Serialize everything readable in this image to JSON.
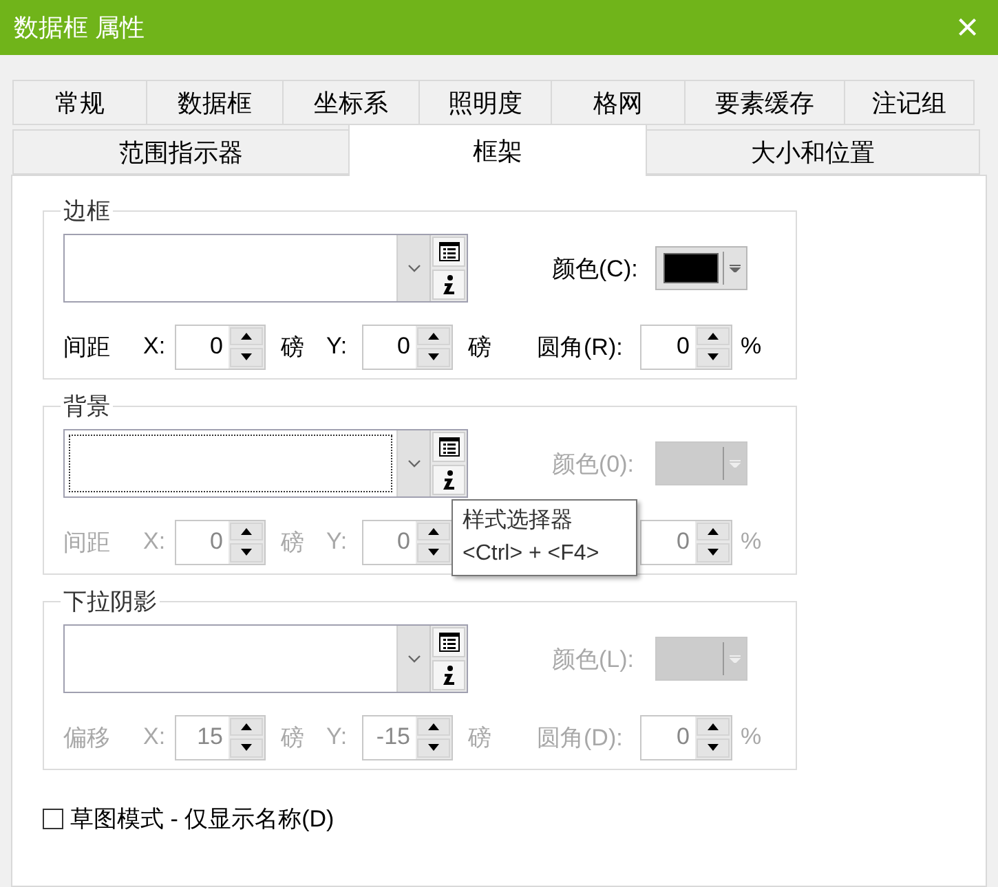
{
  "window": {
    "title": "数据框 属性",
    "close": "×"
  },
  "tab_rows": [
    [
      {
        "label": "常规",
        "selected": false
      },
      {
        "label": "数据框",
        "selected": false
      },
      {
        "label": "坐标系",
        "selected": false
      },
      {
        "label": "照明度",
        "selected": false
      },
      {
        "label": "格网",
        "selected": false
      },
      {
        "label": "要素缓存",
        "selected": false
      },
      {
        "label": "注记组",
        "selected": false
      }
    ],
    [
      {
        "label": "范围指示器",
        "selected": false
      },
      {
        "label": "框架",
        "selected": true
      },
      {
        "label": "大小和位置",
        "selected": false
      }
    ]
  ],
  "groups": [
    {
      "title": "边框",
      "disabled": false,
      "combo_focused": false,
      "color_label": "颜色(C):",
      "color": "#000000",
      "offset_label": "间距",
      "x": {
        "label": "X:",
        "value": "0",
        "unit": "磅"
      },
      "y": {
        "label": "Y:",
        "value": "0",
        "unit": "磅"
      },
      "corner": {
        "label": "圆角(R):",
        "value": "0",
        "unit": "%"
      }
    },
    {
      "title": "背景",
      "disabled": true,
      "combo_focused": true,
      "color_label": "颜色(0):",
      "offset_label": "间距",
      "x": {
        "label": "X:",
        "value": "0",
        "unit": "磅"
      },
      "y": {
        "label": "Y:",
        "value": "0"
      },
      "corner": {
        "value": "0",
        "unit": "%"
      }
    },
    {
      "title": "下拉阴影",
      "disabled": true,
      "combo_focused": false,
      "color_label": "颜色(L):",
      "offset_label": "偏移",
      "x": {
        "label": "X:",
        "value": "15",
        "unit": "磅"
      },
      "y": {
        "label": "Y:",
        "value": "-15",
        "unit": "磅"
      },
      "corner": {
        "label": "圆角(D):",
        "value": "0",
        "unit": "%"
      }
    }
  ],
  "draft_mode": {
    "label": "草图模式 - 仅显示名称(D)",
    "checked": false
  },
  "tooltip": {
    "lines": [
      "样式选择器",
      "<Ctrl> + <F4>"
    ]
  }
}
